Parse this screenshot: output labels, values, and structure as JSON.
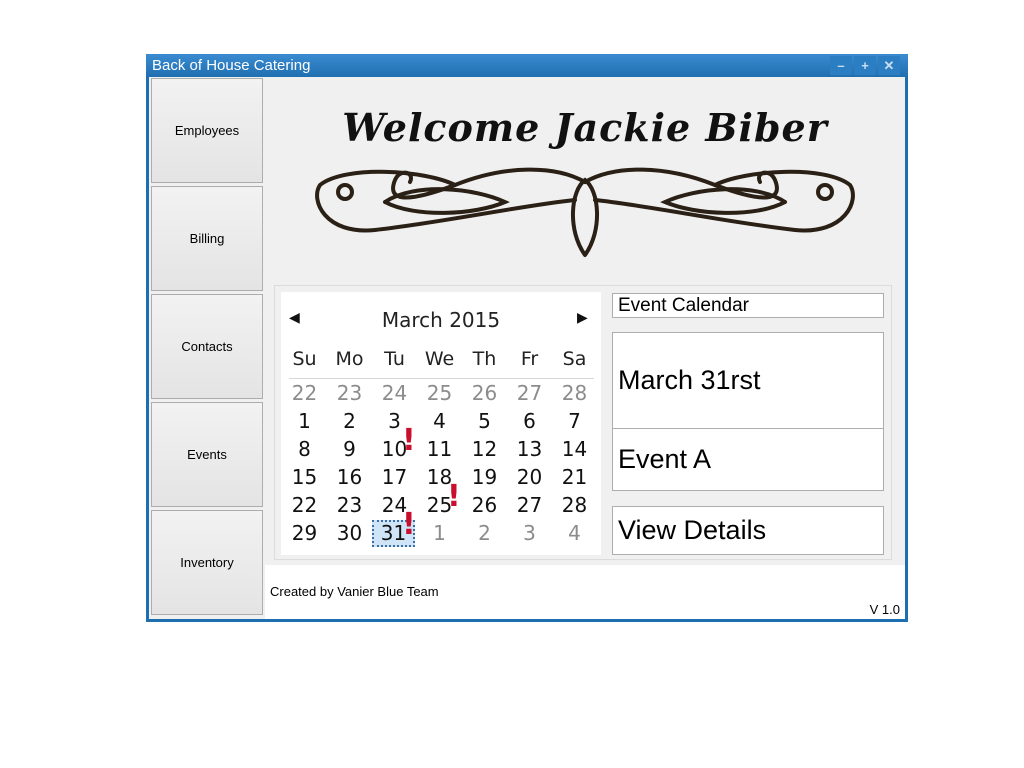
{
  "window": {
    "title": "Back of House Catering"
  },
  "nav": [
    {
      "label": "Employees"
    },
    {
      "label": "Billing"
    },
    {
      "label": "Contacts"
    },
    {
      "label": "Events"
    },
    {
      "label": "Inventory"
    }
  ],
  "welcome": {
    "text": "Welcome Jackie Biber"
  },
  "calendar": {
    "month_label": "March 2015",
    "days_of_week": [
      "Su",
      "Mo",
      "Tu",
      "We",
      "Th",
      "Fr",
      "Sa"
    ],
    "weeks": [
      [
        "22",
        "23",
        "24",
        "25",
        "26",
        "27",
        "28"
      ],
      [
        "1",
        "2",
        "3",
        "4",
        "5",
        "6",
        "7"
      ],
      [
        "8",
        "9",
        "10",
        "11",
        "12",
        "13",
        "14"
      ],
      [
        "15",
        "16",
        "17",
        "18",
        "19",
        "20",
        "21"
      ],
      [
        "22",
        "23",
        "24",
        "25",
        "26",
        "27",
        "28"
      ],
      [
        "29",
        "30",
        "31",
        "1",
        "2",
        "3",
        "4"
      ]
    ],
    "selected": "31",
    "event_marks": [
      "10",
      "25",
      "31"
    ],
    "mark_symbol": "!",
    "mark_color": "#c8102e"
  },
  "event_panel": {
    "header": "Event Calendar",
    "date": "March 31rst",
    "event": "Event A",
    "details_button": "View Details"
  },
  "footer": {
    "credit": "Created by Vanier Blue Team",
    "version": "V 1.0"
  }
}
